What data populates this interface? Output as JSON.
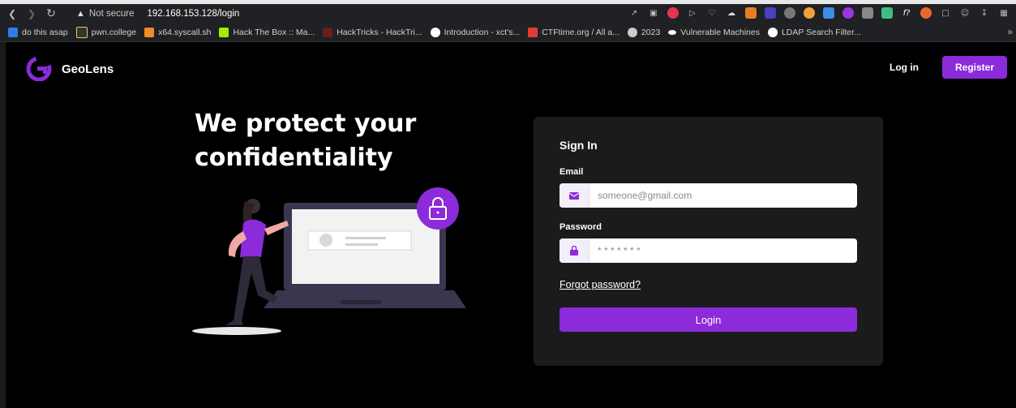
{
  "browser": {
    "security_label": "Not secure",
    "url": "192.168.153.128/login",
    "bookmarks": [
      {
        "label": "do this asap",
        "color": "#2f7be8"
      },
      {
        "label": "pwn.college",
        "color": "#f2c94c"
      },
      {
        "label": "x64.syscall.sh",
        "color": "#f28c28"
      },
      {
        "label": "Hack The Box :: Ma...",
        "color": "#9fef00"
      },
      {
        "label": "HackTricks - HackTri...",
        "color": "#d32f2f"
      },
      {
        "label": "Introduction - xct's...",
        "color": "#ffffff"
      },
      {
        "label": "CTFtime.org / All a...",
        "color": "#e53935"
      },
      {
        "label": "2023",
        "color": "#cccccc"
      },
      {
        "label": "Vulnerable Machines",
        "color": "#ffffff"
      },
      {
        "label": "LDAP Search Filter...",
        "color": "#ffffff"
      }
    ]
  },
  "header": {
    "brand": "GeoLens",
    "login_link": "Log in",
    "register_button": "Register"
  },
  "hero": {
    "line1": "We protect your",
    "line2": "confidentiality"
  },
  "signin": {
    "title": "Sign In",
    "email_label": "Email",
    "email_placeholder": "someone@gmail.com",
    "password_label": "Password",
    "password_placeholder": "* * * * * * *",
    "forgot_link": "Forgot password?",
    "login_button": "Login"
  },
  "colors": {
    "accent": "#8c2bd9",
    "card_bg": "#1b1b1b",
    "page_bg": "#000000"
  }
}
